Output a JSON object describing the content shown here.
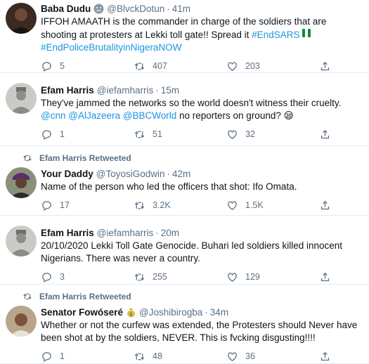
{
  "tweets": [
    {
      "name": "Baba Dudu",
      "handle": "@BlvckDotun",
      "time": "41m",
      "text_plain": "IFFOH AMAATH is the commander in charge of the soldiers that are shooting at protesters at Lekki toll gate!! Spread it ",
      "hashtag1": "#EndSARS",
      "hashtag2": "#EndPoliceBrutalityinNigeraNOW",
      "replies": "5",
      "retweets": "407",
      "likes": "203"
    },
    {
      "name": "Efam Harris",
      "handle": "@iefamharris",
      "time": "15m",
      "text_plain": "They've jammed the networks so the world doesn't witness their cruelty.",
      "mention1": "@cnn",
      "mention2": "@AlJazeera",
      "mention3": "@BBCWorld",
      "text_tail": " no reporters on ground? 😪",
      "replies": "1",
      "retweets": "51",
      "likes": "32"
    },
    {
      "retweeted_by": "Efam Harris Retweeted",
      "name": "Your Daddy",
      "handle": "@ToyosiGodwin",
      "time": "42m",
      "text_plain": "Name of the person who led the officers that shot: Ifo Omata.",
      "replies": "17",
      "retweets": "3.2K",
      "likes": "1.5K"
    },
    {
      "name": "Efam Harris",
      "handle": "@iefamharris",
      "time": "20m",
      "text_plain": "20/10/2020 Lekki Toll Gate Genocide. Buhari led soldiers killed innocent Nigerians. There was never a country.",
      "replies": "3",
      "retweets": "255",
      "likes": "129"
    },
    {
      "retweeted_by": "Efam Harris Retweeted",
      "name": "Senator Fowóseré",
      "handle": "@Joshibirogba",
      "time": "34m",
      "text_plain": "Whether or not the curfew was extended, the Protesters should Never have been shot at by the soldiers, NEVER. This is fvcking disgusting!!!!",
      "replies": "1",
      "retweets": "48",
      "likes": "36"
    }
  ],
  "sep": "·",
  "colors": {
    "accent": "#1b95e0",
    "muted": "#5b7083",
    "border": "#e6ecf0"
  }
}
